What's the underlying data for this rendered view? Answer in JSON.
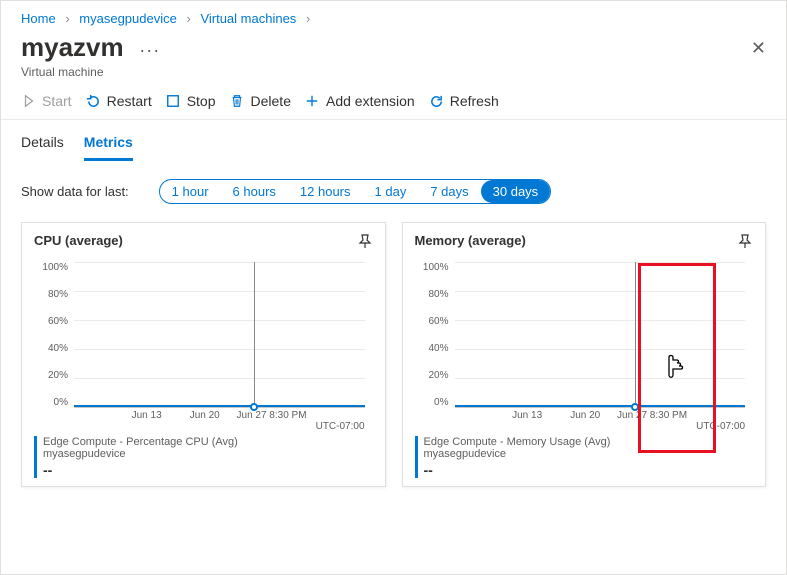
{
  "breadcrumb": {
    "home": "Home",
    "device": "myasegpudevice",
    "vms": "Virtual machines"
  },
  "header": {
    "title": "myazvm",
    "subtitle": "Virtual machine"
  },
  "toolbar": {
    "start": "Start",
    "restart": "Restart",
    "stop": "Stop",
    "delete": "Delete",
    "add_extension": "Add extension",
    "refresh": "Refresh"
  },
  "tabs": {
    "details": "Details",
    "metrics": "Metrics"
  },
  "filter": {
    "label": "Show data for last:",
    "options": [
      "1 hour",
      "6 hours",
      "12 hours",
      "1 day",
      "7 days",
      "30 days"
    ]
  },
  "cards": {
    "cpu": {
      "title": "CPU (average)",
      "legend_title": "Edge Compute - Percentage CPU (Avg)",
      "legend_sub": "myasegpudevice",
      "value": "--"
    },
    "memory": {
      "title": "Memory (average)",
      "legend_title": "Edge Compute - Memory Usage (Avg)",
      "legend_sub": "myasegpudevice",
      "value": "--"
    }
  },
  "chart_data": [
    {
      "type": "line",
      "title": "CPU (average)",
      "ylabel": "",
      "ylim": [
        0,
        100
      ],
      "y_ticks": [
        "100%",
        "80%",
        "60%",
        "40%",
        "20%",
        "0%"
      ],
      "x_ticks": [
        "Jun 13",
        "Jun 20",
        "Jun 27 8:30 PM"
      ],
      "timezone": "UTC-07:00",
      "series": [
        {
          "name": "Edge Compute - Percentage CPU (Avg)",
          "values": [
            0,
            0,
            0,
            0,
            0,
            0,
            0
          ]
        }
      ],
      "hover_point": {
        "x": "Jun 27 8:30 PM",
        "y": 0
      }
    },
    {
      "type": "line",
      "title": "Memory (average)",
      "ylabel": "",
      "ylim": [
        0,
        100
      ],
      "y_ticks": [
        "100%",
        "80%",
        "60%",
        "40%",
        "20%",
        "0%"
      ],
      "x_ticks": [
        "Jun 13",
        "Jun 20",
        "Jun 27 8:30 PM"
      ],
      "timezone": "UTC-07:00",
      "series": [
        {
          "name": "Edge Compute - Memory Usage (Avg)",
          "values": [
            0,
            0,
            0,
            0,
            0,
            0,
            0
          ]
        }
      ],
      "hover_point": {
        "x": "Jun 27 8:30 PM",
        "y": 0
      }
    }
  ]
}
